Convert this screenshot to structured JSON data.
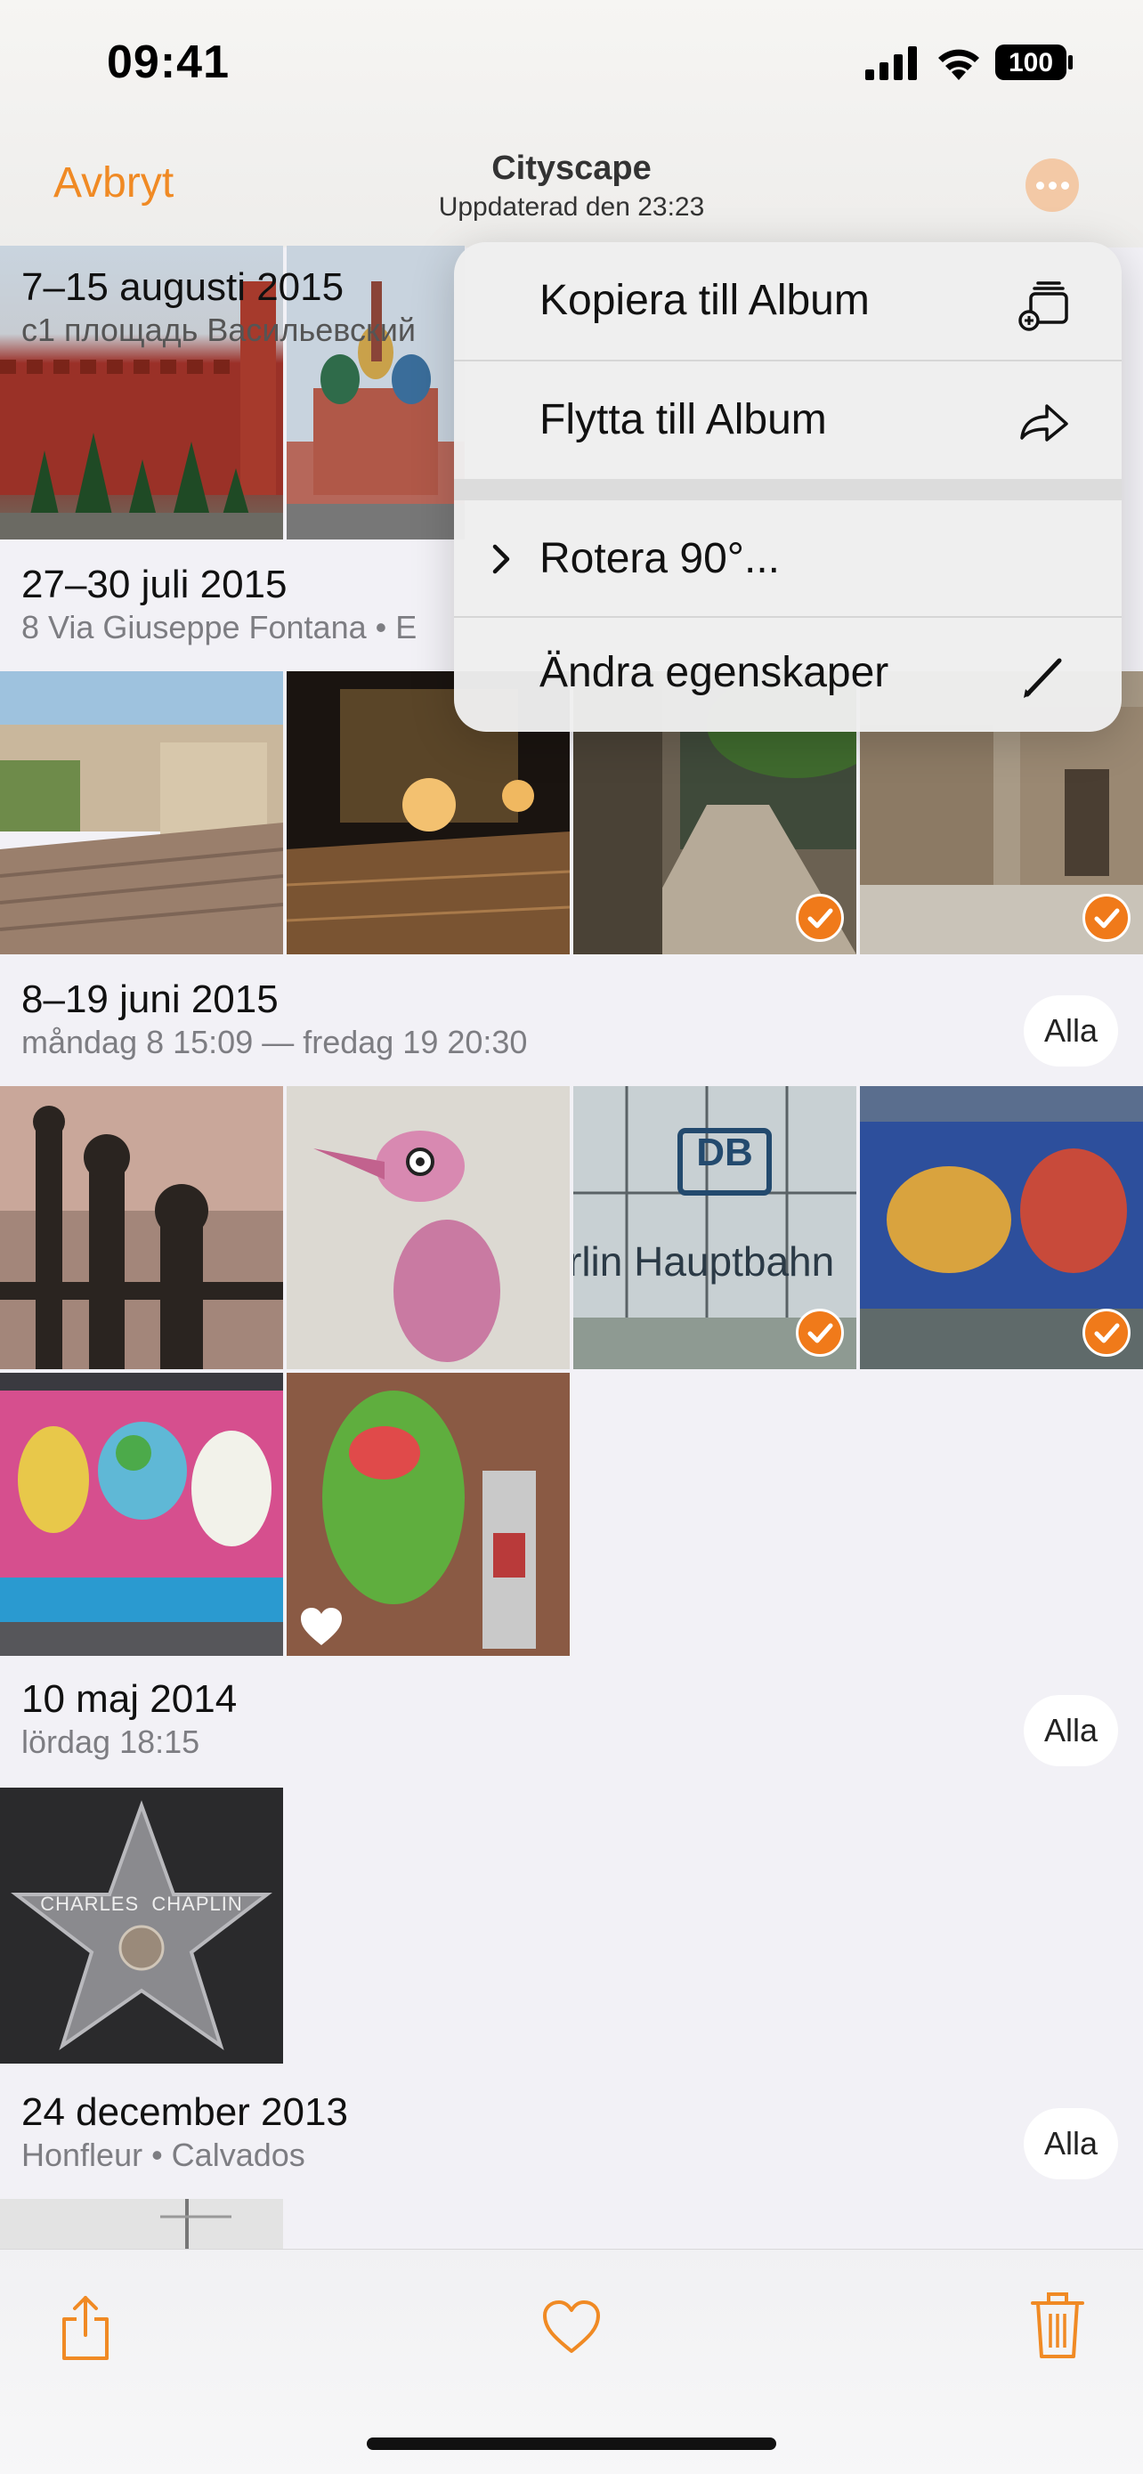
{
  "status_bar": {
    "time": "09:41",
    "battery": "100"
  },
  "nav": {
    "cancel_label": "Avbryt",
    "title": "Cityscape",
    "subtitle": "Uppdaterad den 23:23"
  },
  "sections": [
    {
      "title": "7–15 augusti 2015",
      "subtitle": "с1 площадь Васильевский"
    },
    {
      "title": "27–30 juli 2015",
      "subtitle": "8 Via Giuseppe Fontana • E"
    },
    {
      "title": "8–19 juni 2015",
      "subtitle": "måndag 8 15:09 — fredag 19 20:30",
      "all_label": "Alla"
    },
    {
      "title": "10 maj 2014",
      "subtitle": "lördag 18:15",
      "all_label": "Alla"
    },
    {
      "title": "24 december 2013",
      "subtitle": "Honfleur • Calvados",
      "all_label": "Alla"
    }
  ],
  "photo_texts": {
    "chaplin": "CHARLES  CHAPLIN",
    "db": "DB",
    "hauptbahnhof": "rlin Hauptbahn"
  },
  "menu": {
    "items": [
      {
        "label": "Kopiera till Album",
        "icon": "copy-to-album-icon"
      },
      {
        "label": "Flytta till Album",
        "icon": "move-arrow-icon"
      },
      {
        "label": "Rotera 90°...",
        "icon": "chevron-right-icon"
      },
      {
        "label": "Ändra egenskaper",
        "icon": "pencil-icon"
      }
    ]
  },
  "toolbar": {
    "share_icon": "share-icon",
    "favorite_icon": "heart-icon",
    "delete_icon": "trash-icon"
  },
  "colors": {
    "accent": "#f08a24",
    "check": "#f07a1a",
    "background": "#f2f1f6"
  }
}
